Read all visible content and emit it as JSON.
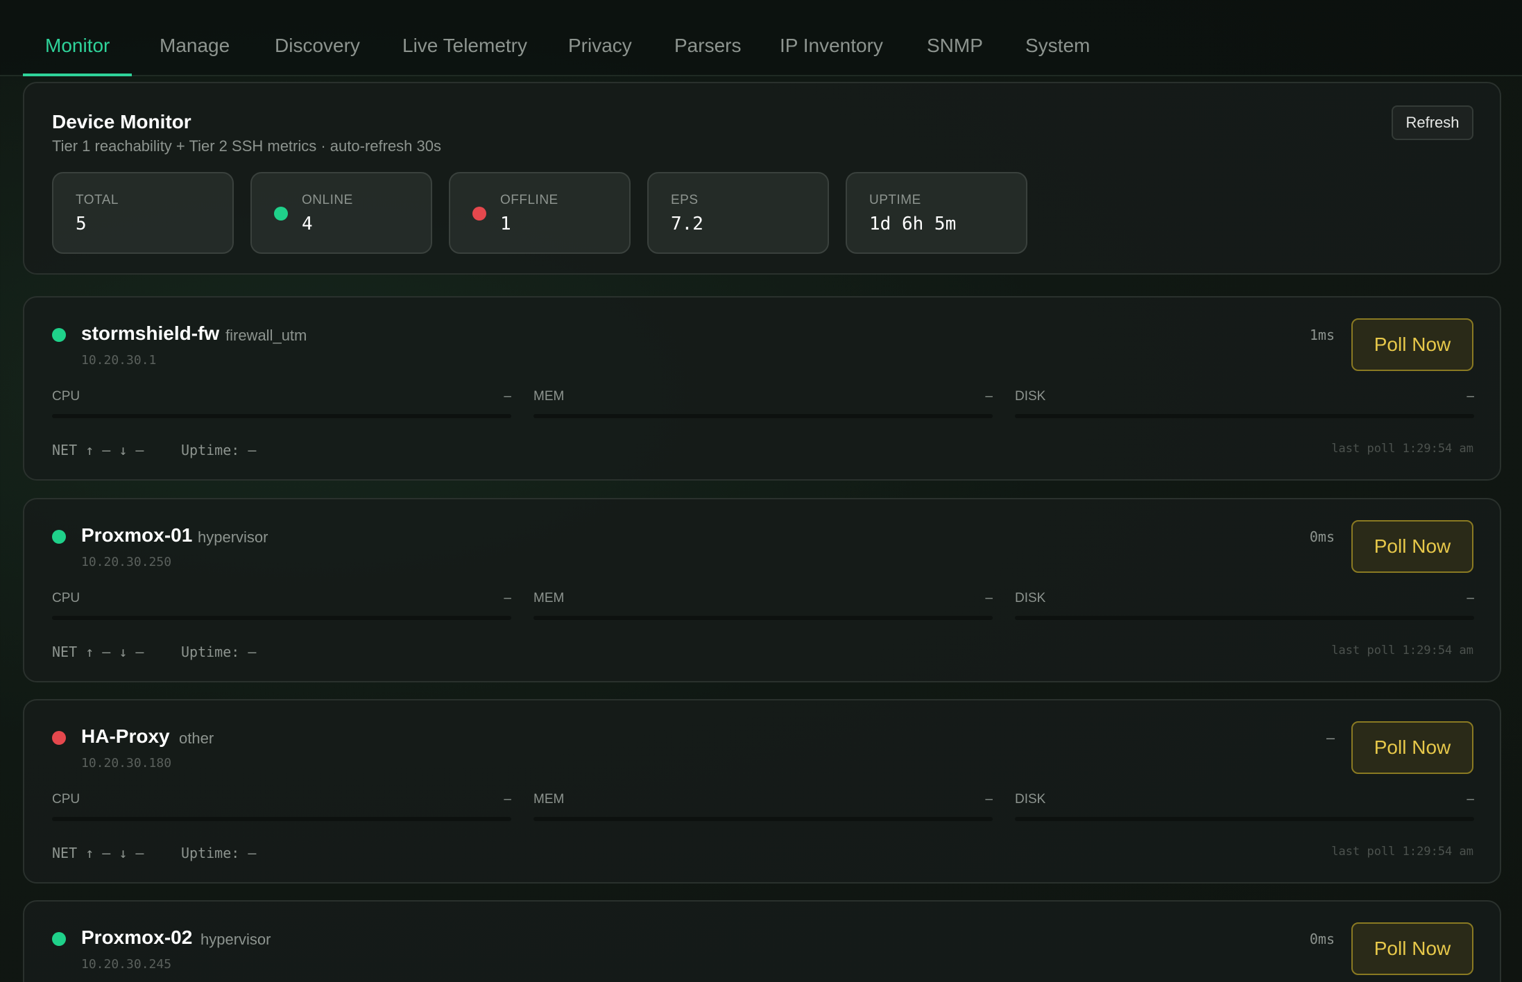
{
  "tabs": [
    {
      "label": "Monitor",
      "active": true
    },
    {
      "label": "Manage",
      "active": false
    },
    {
      "label": "Discovery",
      "active": false
    },
    {
      "label": "Live Telemetry",
      "active": false
    },
    {
      "label": "Privacy",
      "active": false
    },
    {
      "label": "Parsers",
      "active": false
    },
    {
      "label": "IP Inventory",
      "active": false
    },
    {
      "label": "SNMP",
      "active": false
    },
    {
      "label": "System",
      "active": false
    }
  ],
  "summary": {
    "title": "Device Monitor",
    "subtitle": "Tier 1 reachability + Tier 2 SSH metrics · auto-refresh 30s",
    "refresh_label": "Refresh",
    "stats": [
      {
        "label": "TOTAL",
        "value": "5",
        "dot": null
      },
      {
        "label": "ONLINE",
        "value": "4",
        "dot": "#1fd18a"
      },
      {
        "label": "OFFLINE",
        "value": "1",
        "dot": "#e5484d"
      },
      {
        "label": "EPS",
        "value": "7.2",
        "dot": null
      },
      {
        "label": "UPTIME",
        "value": "1d 6h 5m",
        "dot": null
      }
    ]
  },
  "devices": [
    {
      "name": "stormshield-fw",
      "type": "firewall_utm",
      "ip": "10.20.30.1",
      "status": "online",
      "status_color": "#1fd18a",
      "latency": "1ms",
      "poll_label": "Poll Now",
      "cpu_label": "CPU",
      "cpu_value": "–",
      "mem_label": "MEM",
      "mem_value": "–",
      "disk_label": "DISK",
      "disk_value": "–",
      "net": "NET ↑ – ↓ –",
      "uptime": "Uptime: –",
      "last_poll": "last poll 1:29:54 am"
    },
    {
      "name": "Proxmox-01",
      "type": "hypervisor",
      "ip": "10.20.30.250",
      "status": "online",
      "status_color": "#1fd18a",
      "latency": "0ms",
      "poll_label": "Poll Now",
      "cpu_label": "CPU",
      "cpu_value": "–",
      "mem_label": "MEM",
      "mem_value": "–",
      "disk_label": "DISK",
      "disk_value": "–",
      "net": "NET ↑ – ↓ –",
      "uptime": "Uptime: –",
      "last_poll": "last poll 1:29:54 am"
    },
    {
      "name": "HA-Proxy",
      "type": "other",
      "ip": "10.20.30.180",
      "status": "offline",
      "status_color": "#e5484d",
      "latency": "–",
      "poll_label": "Poll Now",
      "cpu_label": "CPU",
      "cpu_value": "–",
      "mem_label": "MEM",
      "mem_value": "–",
      "disk_label": "DISK",
      "disk_value": "–",
      "net": "NET ↑ – ↓ –",
      "uptime": "Uptime: –",
      "last_poll": "last poll 1:29:54 am"
    },
    {
      "name": "Proxmox-02",
      "type": "hypervisor",
      "ip": "10.20.30.245",
      "status": "online",
      "status_color": "#1fd18a",
      "latency": "0ms",
      "poll_label": "Poll Now"
    }
  ]
}
